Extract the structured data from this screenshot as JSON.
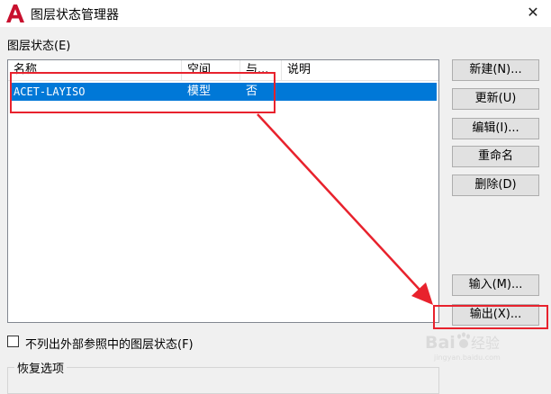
{
  "window": {
    "title": "图层状态管理器",
    "close_glyph": "✕"
  },
  "layer_states": {
    "group_label": "图层状态(E)",
    "columns": [
      "名称",
      "空间",
      "与...",
      "说明"
    ],
    "rows": [
      {
        "name": "ACET-LAYISO",
        "space": "模型",
        "same": "否",
        "description": ""
      }
    ]
  },
  "buttons": {
    "new": "新建(N)...",
    "update": "更新(U)",
    "edit": "编辑(I)...",
    "rename": "重命名",
    "delete": "删除(D)",
    "import": "输入(M)...",
    "export": "输出(X)..."
  },
  "options": {
    "exclude_xref_label": "不列出外部参照中的图层状态(F)",
    "exclude_xref_checked": false,
    "restore_group_label": "恢复选项"
  },
  "watermark": {
    "text": "Baidu经验",
    "brand_text": "jingyan.baidu.com"
  },
  "colors": {
    "selection": "#0078d7",
    "annotation": "#e8222d",
    "logo": "#c8102e"
  },
  "icons": {
    "app_logo": "autocad-a-logo-icon",
    "close": "close-icon",
    "watermark": "baidu-paw-icon"
  }
}
